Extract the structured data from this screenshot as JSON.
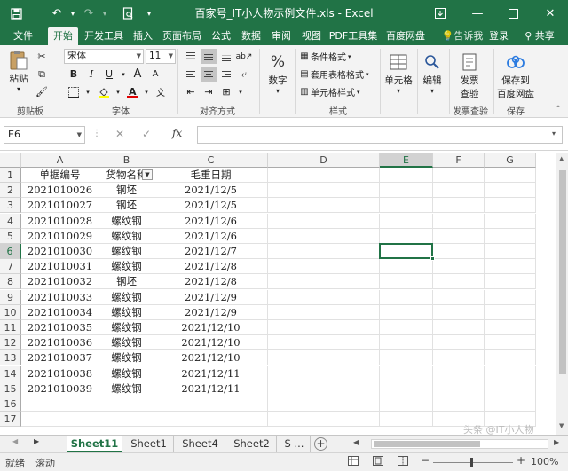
{
  "app": {
    "title": "百家号_IT小人物示例文件.xls - Excel"
  },
  "quick_access": [
    "save-icon",
    "undo-icon",
    "redo-icon",
    "print-preview-icon"
  ],
  "menu_tabs": [
    {
      "label": "文件"
    },
    {
      "label": "开始",
      "active": true
    },
    {
      "label": "开发工具"
    },
    {
      "label": "插入"
    },
    {
      "label": "页面布局"
    },
    {
      "label": "公式"
    },
    {
      "label": "数据"
    },
    {
      "label": "审阅"
    },
    {
      "label": "视图"
    },
    {
      "label": "PDF工具集"
    },
    {
      "label": "百度网盘"
    }
  ],
  "menu_right": {
    "tell_me": "告诉我",
    "login": "登录",
    "share": "共享"
  },
  "ribbon": {
    "clipboard": {
      "paste": "粘贴",
      "group": "剪贴板"
    },
    "font": {
      "name": "宋体",
      "size": "11",
      "group": "字体"
    },
    "alignment": {
      "group": "对齐方式"
    },
    "number": {
      "label": "数字"
    },
    "styles": {
      "conditional": "条件格式",
      "table_format": "套用表格格式",
      "cell_style": "单元格样式",
      "group": "样式"
    },
    "cells": {
      "label": "单元格"
    },
    "editing": {
      "label": "编辑"
    },
    "invoice": {
      "label_line1": "发票",
      "label_line2": "查验",
      "group": "发票查验"
    },
    "save_cloud": {
      "label_line1": "保存到",
      "label_line2": "百度网盘",
      "group": "保存"
    }
  },
  "formula_bar": {
    "name_box": "E6",
    "fx": "fx",
    "value": ""
  },
  "columns": [
    "A",
    "B",
    "C",
    "D",
    "E",
    "F",
    "G"
  ],
  "selected_column": "E",
  "selected_row": 6,
  "rows": [
    [
      "单据编号",
      "货物名称",
      "毛重日期"
    ],
    [
      "2021010026",
      "钢坯",
      "2021/12/5"
    ],
    [
      "2021010027",
      "钢坯",
      "2021/12/5"
    ],
    [
      "2021010028",
      "螺纹钢",
      "2021/12/6"
    ],
    [
      "2021010029",
      "螺纹钢",
      "2021/12/6"
    ],
    [
      "2021010030",
      "螺纹钢",
      "2021/12/7"
    ],
    [
      "2021010031",
      "螺纹钢",
      "2021/12/8"
    ],
    [
      "2021010032",
      "钢坯",
      "2021/12/8"
    ],
    [
      "2021010033",
      "螺纹钢",
      "2021/12/9"
    ],
    [
      "2021010034",
      "螺纹钢",
      "2021/12/9"
    ],
    [
      "2021010035",
      "螺纹钢",
      "2021/12/10"
    ],
    [
      "2021010036",
      "螺纹钢",
      "2021/12/10"
    ],
    [
      "2021010037",
      "螺纹钢",
      "2021/12/10"
    ],
    [
      "2021010038",
      "螺纹钢",
      "2021/12/11"
    ],
    [
      "2021010039",
      "螺纹钢",
      "2021/12/11"
    ],
    [
      "",
      "",
      ""
    ],
    [
      "",
      "",
      ""
    ]
  ],
  "sheet_tabs": [
    {
      "label": "Sheet11",
      "active": true
    },
    {
      "label": "Sheet1"
    },
    {
      "label": "Sheet4"
    },
    {
      "label": "Sheet2"
    },
    {
      "label": "S ..."
    }
  ],
  "status": {
    "ready": "就绪",
    "scroll": "滚动",
    "zoom": "100%"
  },
  "watermark": "头条 @IT小人物",
  "colors": {
    "accent": "#217346"
  }
}
